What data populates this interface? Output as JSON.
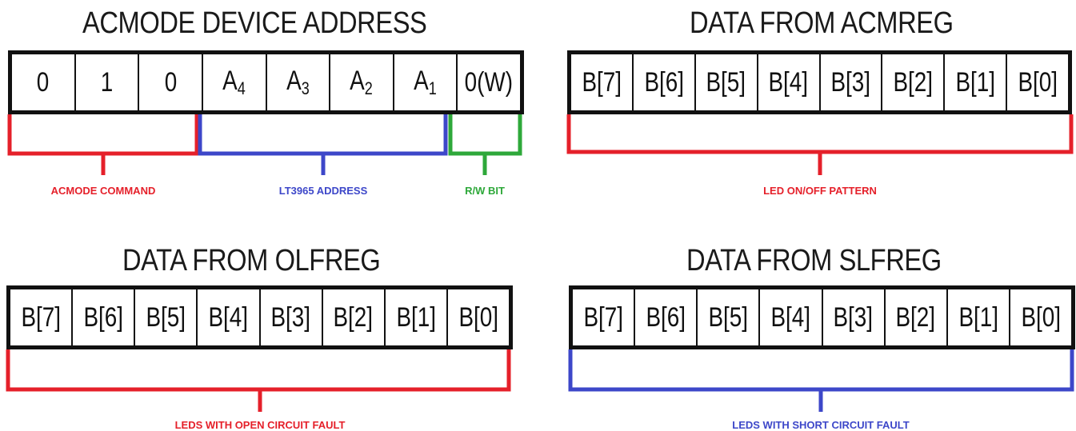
{
  "colors": {
    "red": "#e5202a",
    "blue": "#3d47c9",
    "green": "#2ea83a",
    "black": "#111111"
  },
  "panels": [
    {
      "title": "ACMODE DEVICE ADDRESS",
      "cells": [
        {
          "main": "0",
          "sub": ""
        },
        {
          "main": "1",
          "sub": ""
        },
        {
          "main": "0",
          "sub": ""
        },
        {
          "main": "A",
          "sub": "4"
        },
        {
          "main": "A",
          "sub": "3"
        },
        {
          "main": "A",
          "sub": "2"
        },
        {
          "main": "A",
          "sub": "1"
        },
        {
          "main": "0(W)",
          "sub": ""
        }
      ],
      "fields": [
        {
          "label": "ACMODE COMMAND",
          "color": "red"
        },
        {
          "label": "LT3965 ADDRESS",
          "color": "blue"
        },
        {
          "label": "R/W BIT",
          "color": "green"
        }
      ]
    },
    {
      "title": "DATA FROM ACMREG",
      "cells": [
        {
          "main": "B[7]",
          "sub": ""
        },
        {
          "main": "B[6]",
          "sub": ""
        },
        {
          "main": "B[5]",
          "sub": ""
        },
        {
          "main": "B[4]",
          "sub": ""
        },
        {
          "main": "B[3]",
          "sub": ""
        },
        {
          "main": "B[2]",
          "sub": ""
        },
        {
          "main": "B[1]",
          "sub": ""
        },
        {
          "main": "B[0]",
          "sub": ""
        }
      ],
      "fields": [
        {
          "label": "LED ON/OFF PATTERN",
          "color": "red"
        }
      ]
    },
    {
      "title": "DATA FROM OLFREG",
      "cells": [
        {
          "main": "B[7]",
          "sub": ""
        },
        {
          "main": "B[6]",
          "sub": ""
        },
        {
          "main": "B[5]",
          "sub": ""
        },
        {
          "main": "B[4]",
          "sub": ""
        },
        {
          "main": "B[3]",
          "sub": ""
        },
        {
          "main": "B[2]",
          "sub": ""
        },
        {
          "main": "B[1]",
          "sub": ""
        },
        {
          "main": "B[0]",
          "sub": ""
        }
      ],
      "fields": [
        {
          "label": "LEDS WITH OPEN CIRCUIT FAULT",
          "color": "red"
        }
      ]
    },
    {
      "title": "DATA FROM SLFREG",
      "cells": [
        {
          "main": "B[7]",
          "sub": ""
        },
        {
          "main": "B[6]",
          "sub": ""
        },
        {
          "main": "B[5]",
          "sub": ""
        },
        {
          "main": "B[4]",
          "sub": ""
        },
        {
          "main": "B[3]",
          "sub": ""
        },
        {
          "main": "B[2]",
          "sub": ""
        },
        {
          "main": "B[1]",
          "sub": ""
        },
        {
          "main": "B[0]",
          "sub": ""
        }
      ],
      "fields": [
        {
          "label": "LEDS WITH SHORT CIRCUIT FAULT",
          "color": "blue"
        }
      ]
    }
  ]
}
